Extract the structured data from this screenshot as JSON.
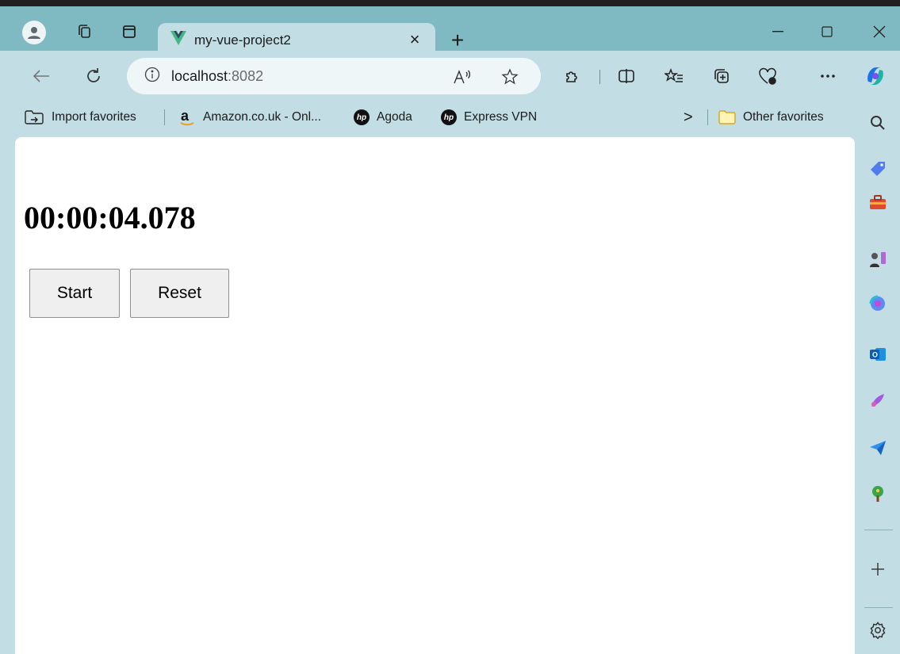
{
  "tab": {
    "title": "my-vue-project2",
    "close_glyph": "×",
    "new_tab_glyph": "+"
  },
  "window_controls": {
    "minimize": "—",
    "maximize": "☐",
    "close": "✕"
  },
  "address_bar": {
    "host": "localhost",
    "port": ":8082"
  },
  "favorites": [
    {
      "label": "Import favorites",
      "icon": "import-icon"
    },
    {
      "label": "Amazon.co.uk - Onl...",
      "icon": "amazon-icon"
    },
    {
      "label": "Agoda",
      "icon": "hp-icon"
    },
    {
      "label": "Express VPN",
      "icon": "hp-icon"
    }
  ],
  "favorites_overflow": ">",
  "other_favorites": "Other favorites",
  "page": {
    "timer": "00:00:04.078",
    "start_label": "Start",
    "reset_label": "Reset"
  },
  "sidebar_icons": [
    "search-icon",
    "shopping-tag-icon",
    "tools-icon",
    "games-icon",
    "copilot-icon",
    "outlook-icon",
    "designer-icon",
    "send-icon",
    "tree-icon",
    "add-icon",
    "settings-icon"
  ],
  "colors": {
    "titlebar": "#7fbac3",
    "chrome": "#c2dde4",
    "page": "#ffffff"
  }
}
